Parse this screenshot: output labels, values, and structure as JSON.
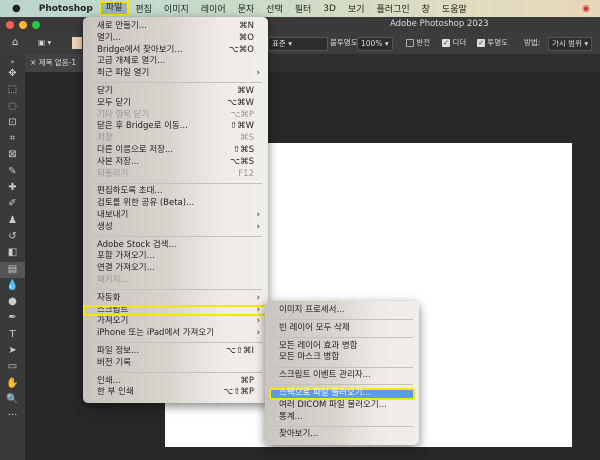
{
  "menubar": {
    "app": "Photoshop",
    "items": [
      "파일",
      "편집",
      "이미지",
      "레이어",
      "문자",
      "선택",
      "필터",
      "3D",
      "보기",
      "플러그인",
      "창",
      "도움말"
    ]
  },
  "window": {
    "title": "Adobe Photoshop 2023"
  },
  "options": {
    "mode_value": "표준",
    "opacity_label": "불투명도:",
    "opacity_value": "100%",
    "reverse": "반전",
    "dither": "디더",
    "transparency": "투명도",
    "method_label": "방법:",
    "method_value": "가시 범위"
  },
  "tab": {
    "title": "제목 없음-1"
  },
  "file_menu": [
    {
      "label": "새로 만들기...",
      "shortcut": "⌘N"
    },
    {
      "label": "열기...",
      "shortcut": "⌘O"
    },
    {
      "label": "Bridge에서 찾아보기...",
      "shortcut": "⌥⌘O"
    },
    {
      "label": "고급 개체로 열기..."
    },
    {
      "label": "최근 파일 열기",
      "submenu": true
    },
    {
      "sep": true
    },
    {
      "label": "닫기",
      "shortcut": "⌘W"
    },
    {
      "label": "모두 닫기",
      "shortcut": "⌥⌘W"
    },
    {
      "label": "기타 항목 닫기",
      "shortcut": "⌥⌘P",
      "disabled": true
    },
    {
      "label": "닫은 후 Bridge로 이동...",
      "shortcut": "⇧⌘W"
    },
    {
      "label": "저장",
      "shortcut": "⌘S",
      "disabled": true
    },
    {
      "label": "다른 이름으로 저장...",
      "shortcut": "⇧⌘S"
    },
    {
      "label": "사본 저장...",
      "shortcut": "⌥⌘S"
    },
    {
      "label": "되돌리기",
      "shortcut": "F12",
      "disabled": true
    },
    {
      "sep": true
    },
    {
      "label": "편집하도록 초대..."
    },
    {
      "label": "검토를 위한 공유 (Beta)..."
    },
    {
      "label": "내보내기",
      "submenu": true
    },
    {
      "label": "생성",
      "submenu": true
    },
    {
      "sep": true
    },
    {
      "label": "Adobe Stock 검색..."
    },
    {
      "label": "포함 가져오기..."
    },
    {
      "label": "연결 가져오기..."
    },
    {
      "label": "패키지...",
      "disabled": true
    },
    {
      "sep": true
    },
    {
      "label": "자동화",
      "submenu": true
    },
    {
      "label": "스크립트",
      "submenu": true,
      "highlight": true
    },
    {
      "label": "가져오기",
      "submenu": true
    },
    {
      "label": "iPhone 또는 iPad에서 가져오기",
      "submenu": true
    },
    {
      "sep": true
    },
    {
      "label": "파일 정보...",
      "shortcut": "⌥⇧⌘I"
    },
    {
      "label": "버전 기록"
    },
    {
      "sep": true
    },
    {
      "label": "인쇄...",
      "shortcut": "⌘P"
    },
    {
      "label": "한 부 인쇄",
      "shortcut": "⌥⇧⌘P"
    }
  ],
  "scripts_menu": [
    {
      "label": "이미지 프로세서..."
    },
    {
      "sep": true
    },
    {
      "label": "빈 레이어 모두 삭제"
    },
    {
      "sep": true
    },
    {
      "label": "모든 레이어 효과 병합"
    },
    {
      "label": "모든 마스크 병합"
    },
    {
      "sep": true
    },
    {
      "label": "스크립트 이벤트 관리자..."
    },
    {
      "sep": true
    },
    {
      "label": "스택으로 파일 불러오기...",
      "selected": true
    },
    {
      "label": "여러 DICOM 파일 불러오기..."
    },
    {
      "label": "통계..."
    },
    {
      "sep": true
    },
    {
      "label": "찾아보기..."
    }
  ]
}
